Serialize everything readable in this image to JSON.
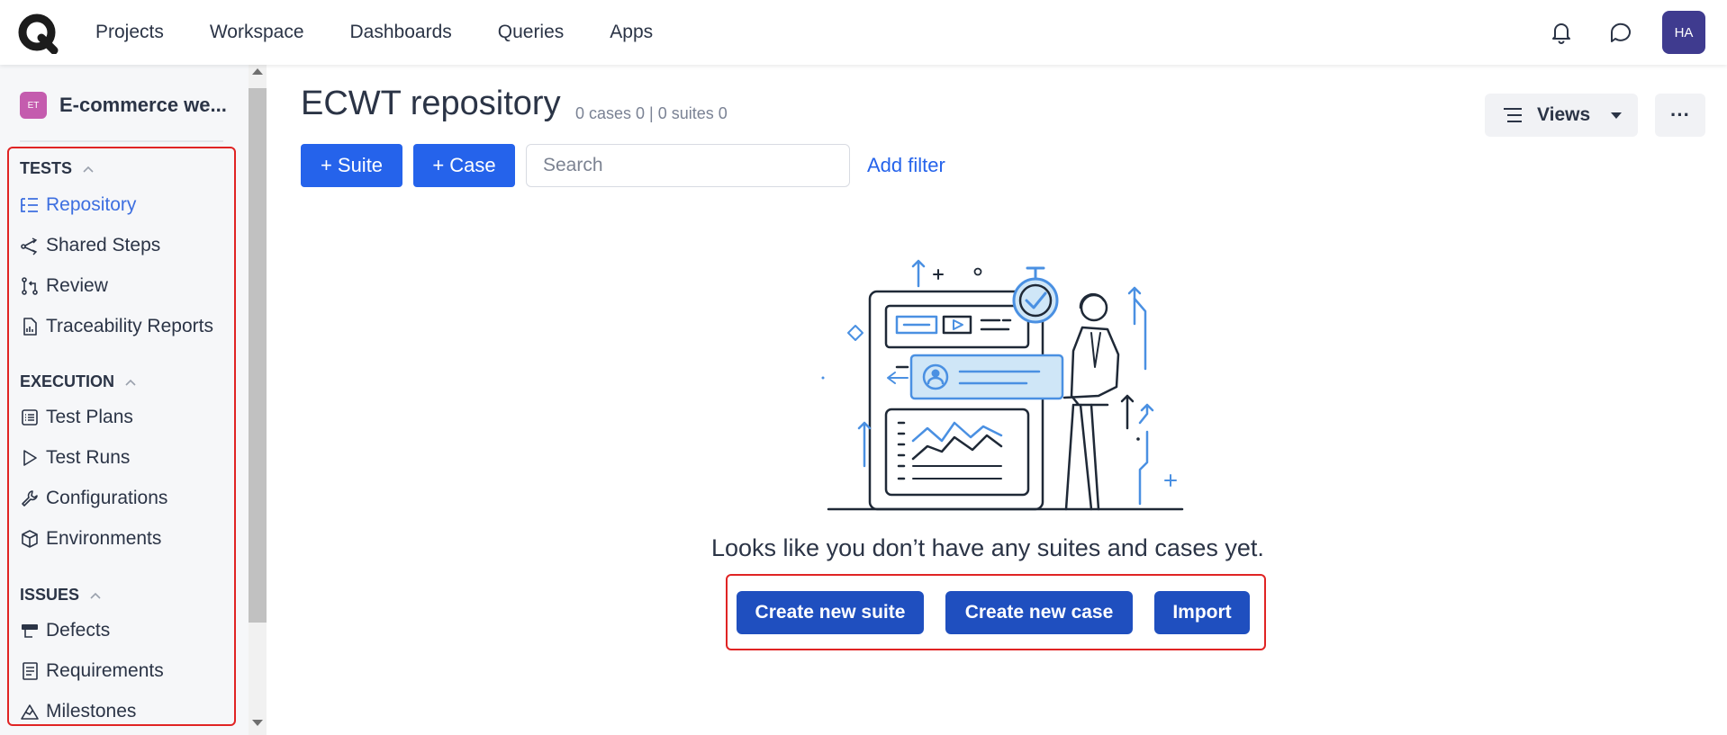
{
  "topnav": {
    "items": [
      "Projects",
      "Workspace",
      "Dashboards",
      "Queries",
      "Apps"
    ],
    "avatar": "HA"
  },
  "sidebar": {
    "project_badge": "ET",
    "project_name": "E-commerce we...",
    "sections": {
      "tests": "TESTS",
      "execution": "EXECUTION",
      "issues": "ISSUES"
    },
    "items": {
      "repository": "Repository",
      "shared_steps": "Shared Steps",
      "review": "Review",
      "traceability": "Traceability Reports",
      "test_plans": "Test Plans",
      "test_runs": "Test Runs",
      "configurations": "Configurations",
      "environments": "Environments",
      "defects": "Defects",
      "requirements": "Requirements",
      "milestones": "Milestones"
    }
  },
  "main": {
    "title": "ECWT repository",
    "meta": "0 cases 0 | 0 suites 0",
    "views_label": "Views",
    "more_label": "···",
    "suite_button": "+ Suite",
    "case_button": "+ Case",
    "search_placeholder": "Search",
    "add_filter": "Add filter",
    "empty_message": "Looks like you don’t have any suites and cases yet.",
    "create_suite": "Create new suite",
    "create_case": "Create new case",
    "import": "Import"
  },
  "colors": {
    "primary": "#2563eb",
    "cta": "#1f4fbf",
    "highlight": "#e02424",
    "avatar": "#3f3b8f",
    "project_badge": "#c45cae"
  }
}
